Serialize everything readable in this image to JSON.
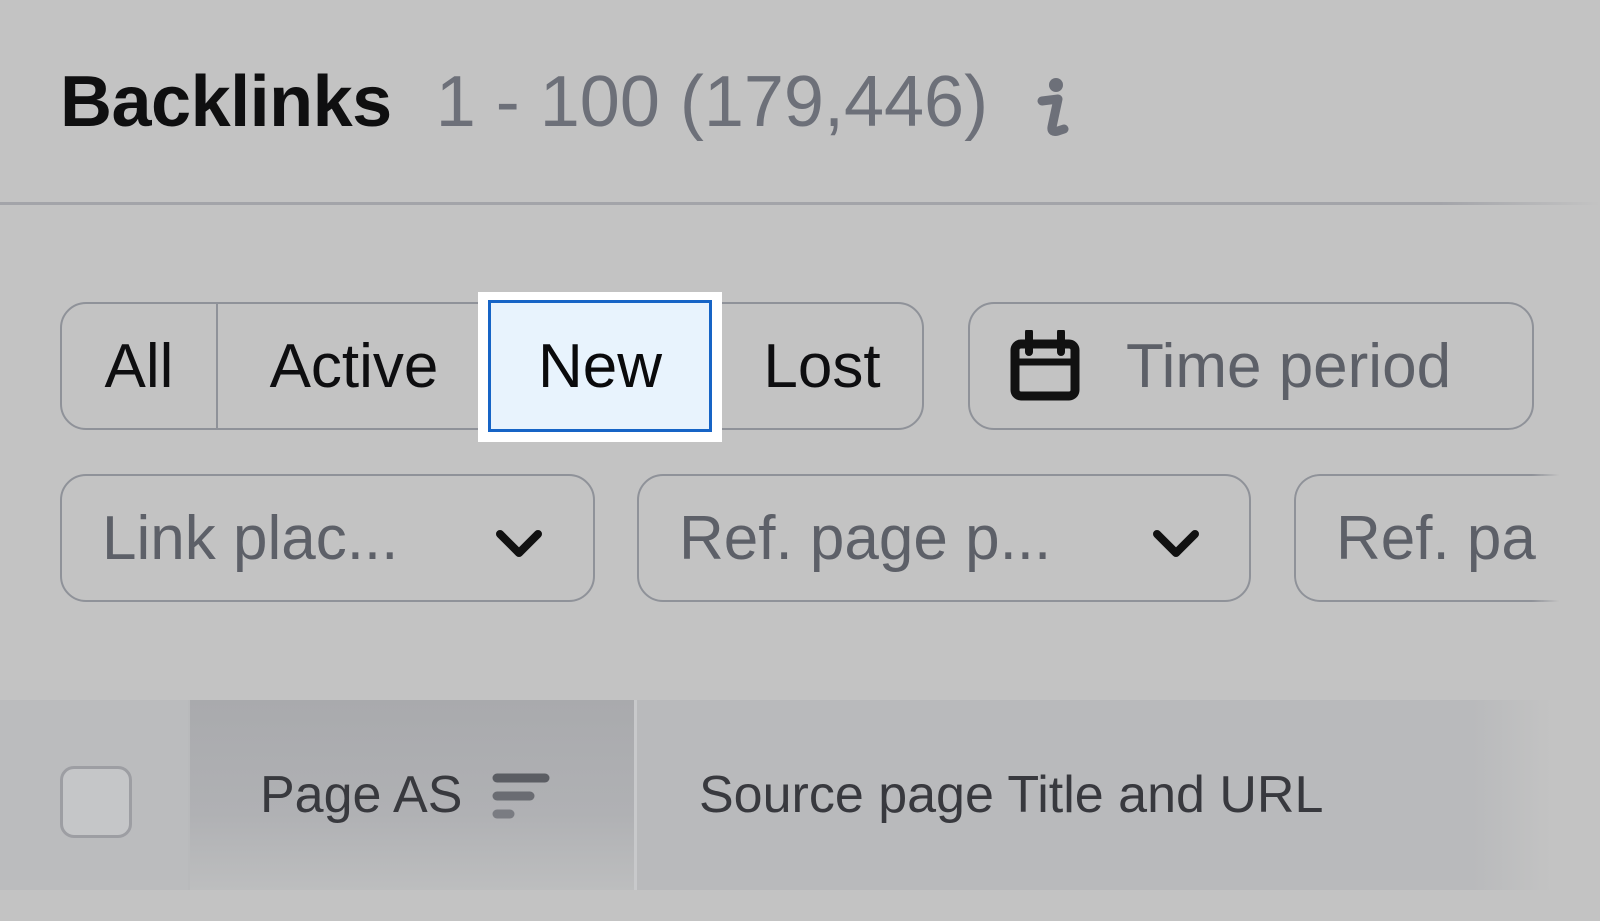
{
  "header": {
    "title": "Backlinks",
    "range": "1 - 100 (179,446)",
    "info_icon": "info-icon"
  },
  "status_tabs": {
    "items": [
      {
        "label": "All",
        "selected": false
      },
      {
        "label": "Active",
        "selected": false
      },
      {
        "label": "New",
        "selected": true
      },
      {
        "label": "Lost",
        "selected": false
      }
    ],
    "selected_border_color": "#1664c6",
    "selected_bg_color": "#e8f3fd"
  },
  "time_period": {
    "icon": "calendar-icon",
    "label": "Time period"
  },
  "filters": [
    {
      "label": "Link plac...",
      "icon": "chevron-down-icon"
    },
    {
      "label": "Ref. page p...",
      "icon": "chevron-down-icon"
    },
    {
      "label": "Ref. pa"
    }
  ],
  "table": {
    "select_all_checked": false,
    "columns": [
      {
        "label": "Page AS",
        "icon": "sort-descending-icon",
        "sorted": true
      },
      {
        "label": "Source page Title and URL"
      }
    ]
  }
}
